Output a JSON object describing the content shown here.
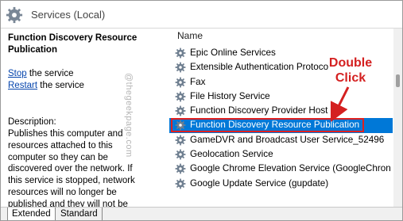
{
  "header": {
    "title": "Services (Local)",
    "icon": "gear-icon"
  },
  "left_pane": {
    "service_name": "Function Discovery Resource Publication",
    "actions": [
      {
        "link": "Stop",
        "text": " the service"
      },
      {
        "link": "Restart",
        "text": " the service"
      }
    ],
    "description_label": "Description:",
    "description": "Publishes this computer and resources attached to this computer so they can be discovered over the network.  If this service is stopped, network resources will no longer be published and they will not be"
  },
  "list": {
    "column_header": "Name",
    "rows": [
      "Epic Online Services",
      "Extensible Authentication Protoco",
      "Fax",
      "File History Service",
      "Function Discovery Provider Host",
      "Function Discovery Resource Publication",
      "GameDVR and Broadcast User Service_52496",
      "Geolocation Service",
      "Google Chrome Elevation Service (GoogleChron",
      "Google Update Service (gupdate)"
    ],
    "selected_index": 5
  },
  "tabs": {
    "extended": "Extended",
    "standard": "Standard"
  },
  "annotation": {
    "line1": "Double",
    "line2": "Click",
    "color": "#d42020"
  },
  "watermark": "@thegeekpage.com",
  "colors": {
    "selection": "#0078d7",
    "link": "#0645ad"
  }
}
